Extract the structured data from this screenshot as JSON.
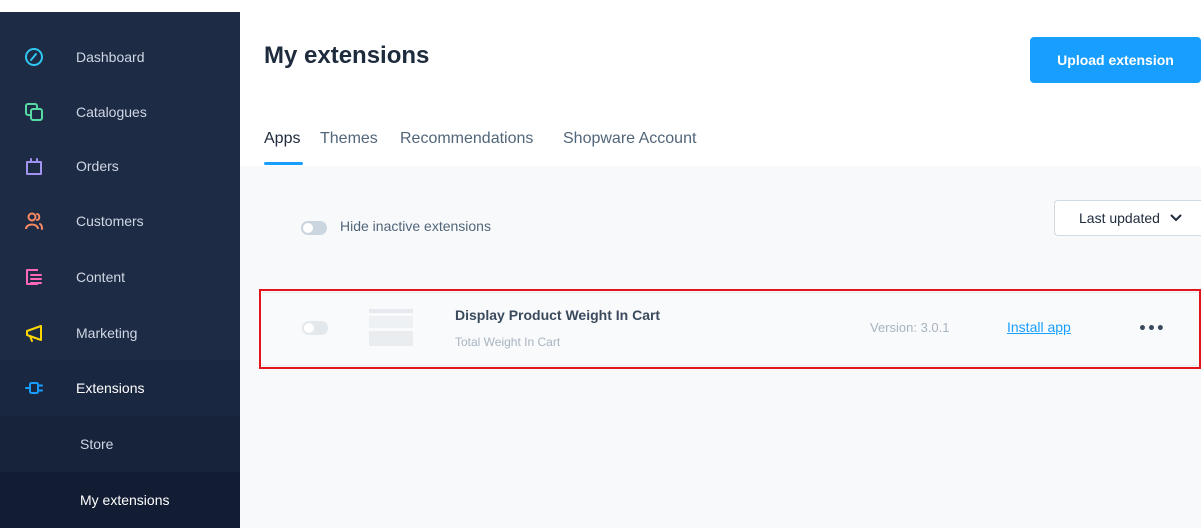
{
  "sidebar": {
    "items": [
      {
        "label": "Dashboard",
        "icon": "dashboard-icon",
        "color": "#2fc6f0"
      },
      {
        "label": "Catalogues",
        "icon": "catalogues-icon",
        "color": "#57d9a3"
      },
      {
        "label": "Orders",
        "icon": "orders-icon",
        "color": "#a092f0"
      },
      {
        "label": "Customers",
        "icon": "customers-icon",
        "color": "#f88962"
      },
      {
        "label": "Content",
        "icon": "content-icon",
        "color": "#ff68b4"
      },
      {
        "label": "Marketing",
        "icon": "marketing-icon",
        "color": "#ffd700"
      },
      {
        "label": "Extensions",
        "icon": "extensions-icon",
        "color": "#189eff"
      }
    ],
    "sub_items": [
      {
        "label": "Store"
      },
      {
        "label": "My extensions"
      }
    ]
  },
  "header": {
    "title": "My extensions",
    "upload_label": "Upload extension"
  },
  "tabs": [
    {
      "label": "Apps"
    },
    {
      "label": "Themes"
    },
    {
      "label": "Recommendations"
    },
    {
      "label": "Shopware Account"
    }
  ],
  "filters": {
    "hide_inactive_label": "Hide inactive extensions",
    "sort_value": "Last updated"
  },
  "extensions": [
    {
      "name": "Display Product Weight In Cart",
      "description": "Total Weight In Cart",
      "version": "Version: 3.0.1",
      "action": "Install app",
      "more": "•••"
    }
  ]
}
